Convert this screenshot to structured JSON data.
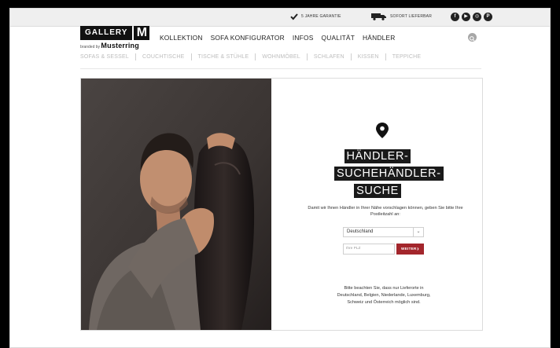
{
  "topbar": {
    "guarantee": "5 JAHRE GARANTIE",
    "delivery": "SOFORT LIEFERBAR",
    "social": [
      {
        "name": "facebook-icon",
        "glyph": "f"
      },
      {
        "name": "youtube-icon",
        "glyph": "▶"
      },
      {
        "name": "instagram-icon",
        "glyph": "◎"
      },
      {
        "name": "pinterest-icon",
        "glyph": "P"
      }
    ]
  },
  "logo": {
    "word": "GALLERY",
    "letter": "M",
    "branded": "branded by",
    "brand": "Musterring"
  },
  "nav": {
    "main": [
      "KOLLEKTION",
      "SOFA KONFIGURATOR",
      "INFOS",
      "QUALITÄT",
      "HÄNDLER"
    ],
    "sub": [
      "SOFAS & SESSEL",
      "COUCHTISCHE",
      "TISCHE & STÜHLE",
      "WOHNMÖBEL",
      "SCHLAFEN",
      "KISSEN",
      "TEPPICHE"
    ]
  },
  "finder": {
    "title": "HÄNDLER-SUCHEHÄNDLER-SUCHE",
    "description": "Damit wir Ihnen Händler in Ihrer Nähe vorschlagen können, geben Sie bitte Ihre Postleitzahl an:",
    "country": "Deutschland",
    "zip_placeholder": "Ihre PLZ",
    "submit": "WEITER",
    "note": "Bitte beachten Sie, dass nur Lieferorte in Deutschland, Belgien, Niederlande, Luxemburg, Schweiz und Österreich möglich sind."
  },
  "colors": {
    "accent": "#a3262c",
    "title_bg": "#1a1a1a"
  }
}
